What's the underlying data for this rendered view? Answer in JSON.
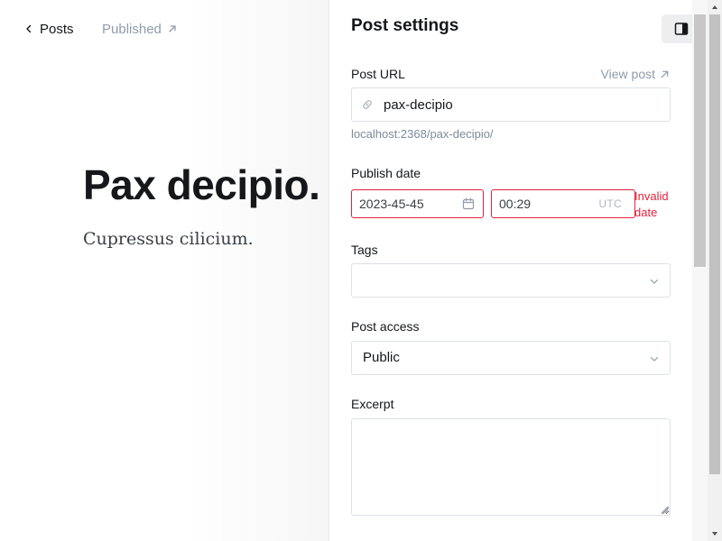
{
  "editor": {
    "back_label": "Posts",
    "status_label": "Published",
    "title": "Pax decipio.",
    "body": "Cupressus cilicium."
  },
  "settings": {
    "title": "Post settings",
    "toggle_icon": "sidebar-toggle-icon",
    "post_url": {
      "label": "Post URL",
      "view_post_label": "View post",
      "value": "pax-decipio",
      "hint": "localhost:2368/pax-decipio/"
    },
    "publish_date": {
      "label": "Publish date",
      "date_value": "2023-45-45",
      "time_value": "00:29",
      "timezone": "UTC",
      "error": "Invalid date"
    },
    "tags": {
      "label": "Tags",
      "value": ""
    },
    "post_access": {
      "label": "Post access",
      "value": "Public"
    },
    "excerpt": {
      "label": "Excerpt",
      "value": ""
    }
  },
  "colors": {
    "text": "#15171a",
    "muted": "#8e9cac",
    "error": "#e1223e",
    "border": "#dde1e5"
  }
}
